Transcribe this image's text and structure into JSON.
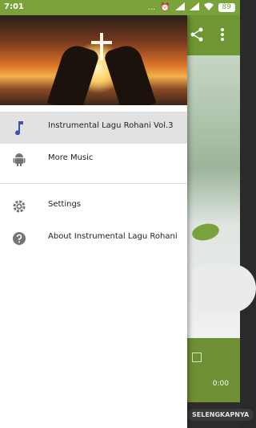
{
  "statusbar": {
    "time": "7:01",
    "dots": "...",
    "battery": "89"
  },
  "player": {
    "time": "0:00",
    "button_label": "SELENGKAPNYA"
  },
  "drawer": {
    "items": [
      {
        "label": "Instrumental Lagu Rohani Vol.3",
        "icon": "music-note-icon",
        "active": true
      },
      {
        "label": "More Music",
        "icon": "android-icon"
      },
      {
        "label": "Settings",
        "icon": "gear-icon"
      },
      {
        "label": "About Instrumental Lagu Rohani",
        "icon": "help-icon"
      }
    ]
  },
  "colors": {
    "accent": "#6e9632",
    "status_bar": "#7aa23a",
    "selected_icon": "#3f51b5"
  }
}
